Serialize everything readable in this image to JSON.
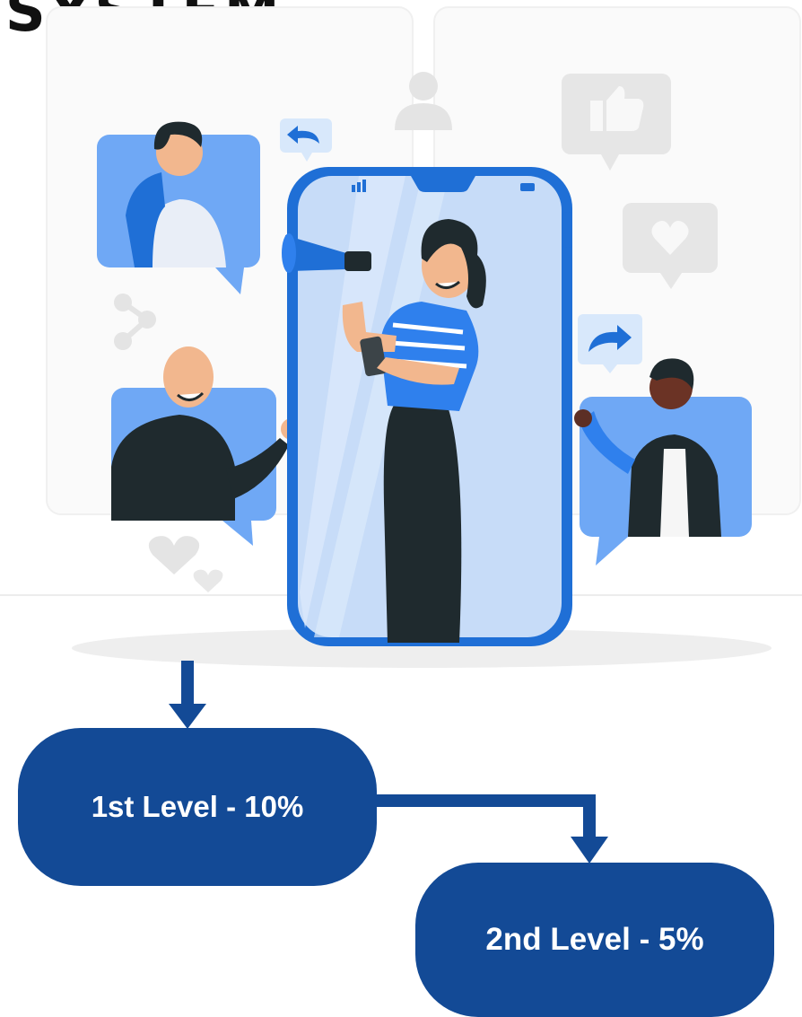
{
  "header": {
    "title": "SYSTEM"
  },
  "levels": [
    {
      "label": "1st Level - 10%"
    },
    {
      "label": "2nd Level - 5%"
    }
  ],
  "colors": {
    "flow_box": "#134a96",
    "accent_blue": "#2f80ed",
    "light_blue": "#9cc3f7",
    "dark_clothing": "#1f2a2e",
    "grey_icon": "#e6e6e6"
  }
}
